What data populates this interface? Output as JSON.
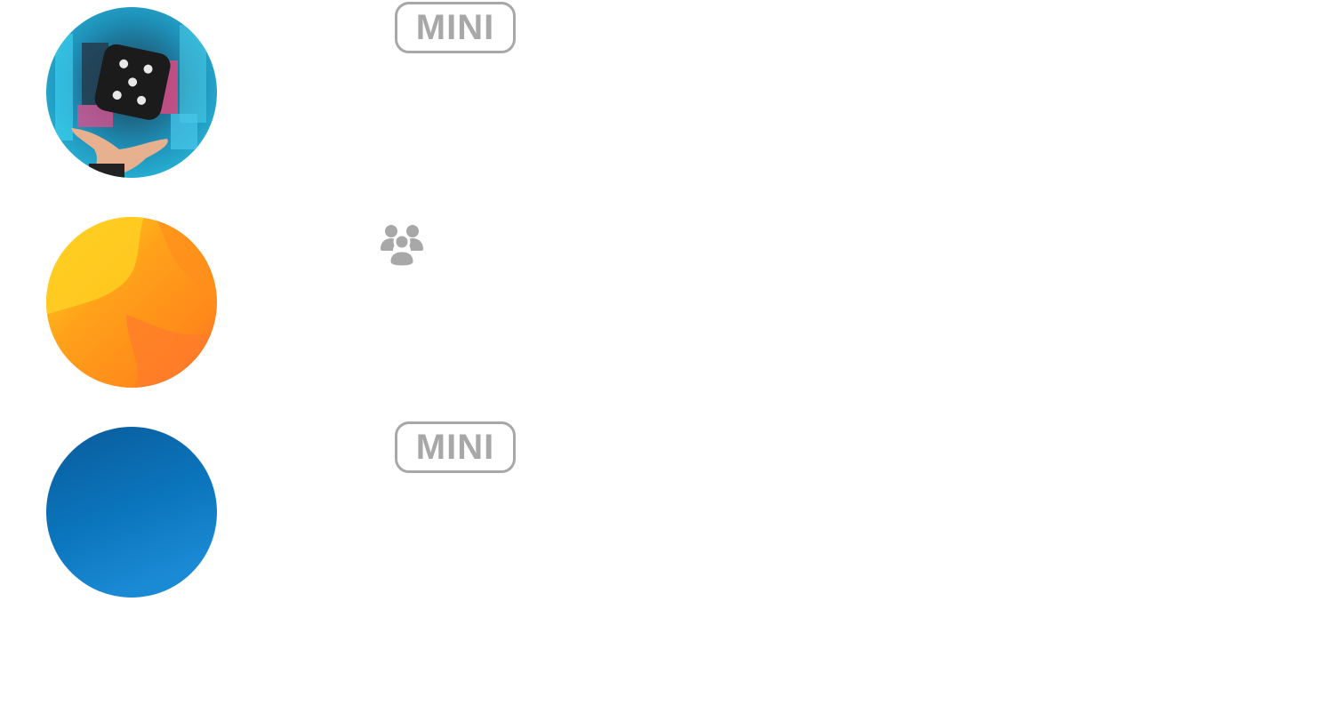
{
  "rows": [
    {
      "avatar_icon": "dice-photo-avatar",
      "badge_label": "MINI"
    },
    {
      "avatar_icon": "orange-gradient-avatar",
      "type_icon": "group-icon"
    },
    {
      "avatar_icon": "blue-gradient-avatar",
      "badge_label": "MINI"
    }
  ],
  "colors": {
    "badge": "#a8a8a8",
    "icon": "#a8a8a8",
    "blue_avatar": "#0b6fb4",
    "orange_avatar": "#ff9a1a"
  }
}
